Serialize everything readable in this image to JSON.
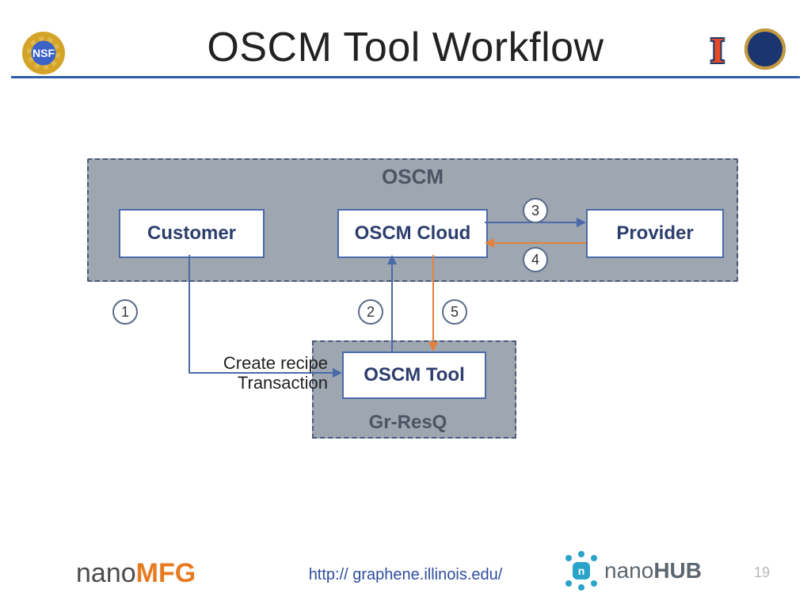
{
  "title": "OSCM Tool Workflow",
  "logos": {
    "nsf_text": "NSF",
    "illinois_text": "I"
  },
  "diagram": {
    "container_label": "OSCM",
    "secondary_container_label": "Gr-ResQ",
    "nodes": {
      "customer": "Customer",
      "cloud": "OSCM Cloud",
      "provider": "Provider",
      "tool": "OSCM Tool"
    },
    "steps": {
      "s1": "1",
      "s2": "2",
      "s3": "3",
      "s4": "4",
      "s5": "5"
    },
    "annotation_line1": "Create recipe",
    "annotation_line2": "Transaction",
    "edges": [
      {
        "id": 1,
        "from": "Customer",
        "to": "OSCM Tool",
        "color": "blue",
        "label": "Create recipe Transaction"
      },
      {
        "id": 2,
        "from": "OSCM Tool",
        "to": "OSCM Cloud",
        "color": "blue"
      },
      {
        "id": 3,
        "from": "OSCM Cloud",
        "to": "Provider",
        "color": "blue"
      },
      {
        "id": 4,
        "from": "Provider",
        "to": "OSCM Cloud",
        "color": "orange"
      },
      {
        "id": 5,
        "from": "OSCM Cloud",
        "to": "OSCM Tool",
        "color": "orange"
      }
    ]
  },
  "footer": {
    "nanoMFG_nano": "nano",
    "nanoMFG_mfg": "MFG",
    "url": "http:// graphene.illinois.edu/",
    "nanoHUB_nano": "nano",
    "nanoHUB_hub": "HUB",
    "page_number": "19"
  }
}
